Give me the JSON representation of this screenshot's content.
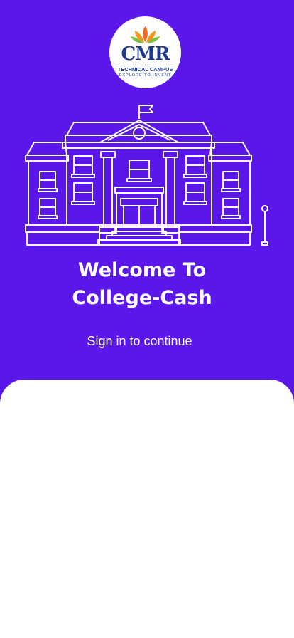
{
  "logo": {
    "name": "CMR",
    "subtitle": "TECHNICAL CAMPUS",
    "tagline": "EXPLORE TO INVENT"
  },
  "welcome": {
    "line1": "Welcome To",
    "line2": "College-Cash"
  },
  "subtitle": "Sign in to continue",
  "colors": {
    "background": "#5b17ea",
    "sheet": "#ffffff",
    "logo_text": "#1f3a8a",
    "petal_orange": "#f26a21",
    "petal_green": "#7cc242"
  },
  "illustration": "college-building-icon"
}
